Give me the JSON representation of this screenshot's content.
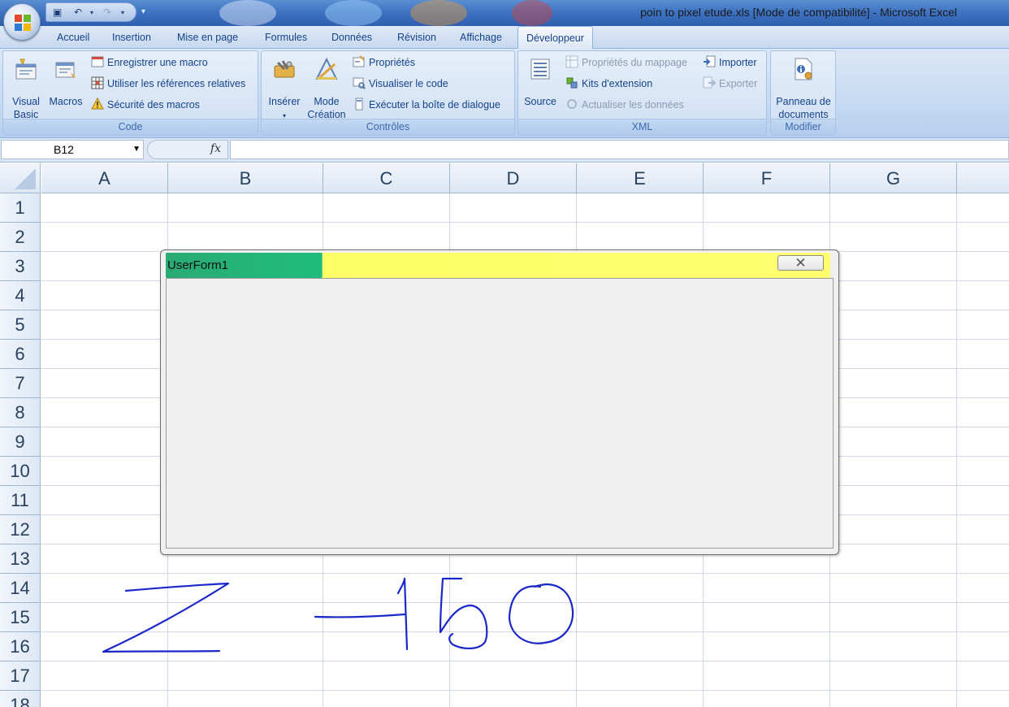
{
  "window": {
    "title": "poin to pixel etude.xls  [Mode de compatibilité] - Microsoft Excel"
  },
  "ribbon_tabs": [
    "Accueil",
    "Insertion",
    "Mise en page",
    "Formules",
    "Données",
    "Révision",
    "Affichage",
    "Développeur"
  ],
  "active_tab": "Développeur",
  "groups": {
    "code": {
      "label": "Code",
      "visual_basic": "Visual Basic",
      "macros": "Macros",
      "record_macro": "Enregistrer une macro",
      "relative_refs": "Utiliser les références relatives",
      "macro_security": "Sécurité des macros"
    },
    "controls": {
      "label": "Contrôles",
      "insert": "Insérer",
      "design_mode": "Mode Création",
      "properties": "Propriétés",
      "view_code": "Visualiser le code",
      "run_dialog": "Exécuter la boîte de dialogue"
    },
    "xml": {
      "label": "XML",
      "source": "Source",
      "map_properties": "Propriétés du mappage",
      "expansion_packs": "Kits d'extension",
      "refresh_data": "Actualiser les données",
      "import": "Importer",
      "export": "Exporter"
    },
    "modify": {
      "label": "Modifier",
      "document_panel": "Panneau de documents"
    }
  },
  "formula_bar": {
    "name_box": "B12",
    "fx": "fx",
    "formula": ""
  },
  "columns": [
    "A",
    "B",
    "C",
    "D",
    "E",
    "F",
    "G"
  ],
  "rows": [
    "1",
    "2",
    "3",
    "4",
    "5",
    "6",
    "7",
    "8",
    "9",
    "10",
    "11",
    "12",
    "13",
    "14",
    "15",
    "16",
    "17",
    "18"
  ],
  "userform": {
    "title": "UserForm1",
    "close": "✕"
  },
  "handwriting": {
    "text": "Z -150",
    "color": "#1a27c9"
  },
  "colors": {
    "title_green": "#1fbd7d",
    "title_yellow": "#ffff66"
  }
}
